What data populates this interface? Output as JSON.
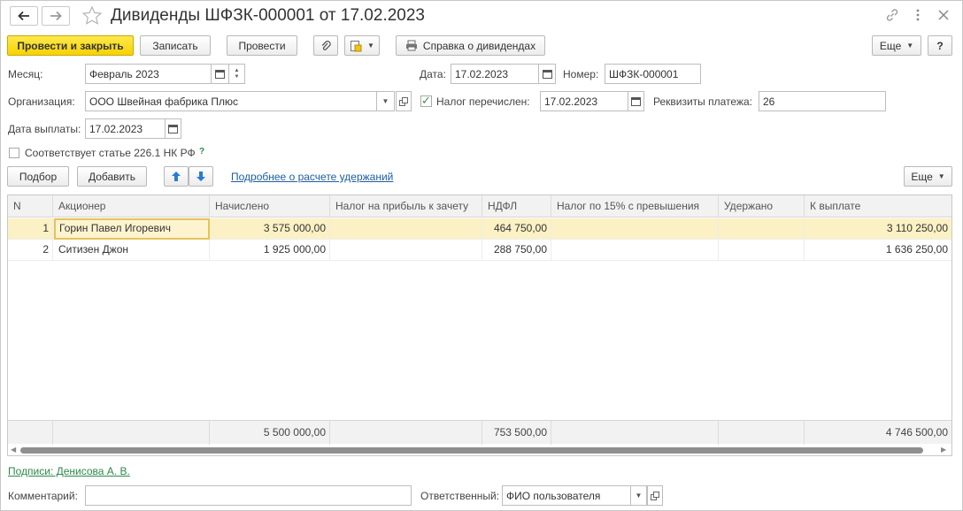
{
  "window": {
    "title": "Дивиденды ШФЗК-000001 от 17.02.2023"
  },
  "toolbar": {
    "post_close": "Провести и закрыть",
    "save": "Записать",
    "post": "Провести",
    "reference": "Справка о дивидендах",
    "more": "Еще",
    "help": "?"
  },
  "form": {
    "month_label": "Месяц:",
    "month_value": "Февраль 2023",
    "date_label": "Дата:",
    "date_value": "17.02.2023",
    "number_label": "Номер:",
    "number_value": "ШФЗК-000001",
    "org_label": "Организация:",
    "org_value": "ООО Швейная фабрика Плюс",
    "tax_paid_label": "Налог перечислен:",
    "tax_paid_date": "17.02.2023",
    "payment_details_label": "Реквизиты платежа:",
    "payment_details_value": "26",
    "pay_date_label": "Дата выплаты:",
    "pay_date_value": "17.02.2023",
    "article_label": "Соответствует статье 226.1 НК РФ",
    "article_help": "?"
  },
  "table_toolbar": {
    "select": "Подбор",
    "add": "Добавить",
    "details_link": "Подробнее о расчете удержаний",
    "more": "Еще"
  },
  "table": {
    "columns": [
      "N",
      "Акционер",
      "Начислено",
      "Налог на прибыль к зачету",
      "НДФЛ",
      "Налог по 15% с превышения",
      "Удержано",
      "К выплате"
    ],
    "rows": [
      {
        "n": "1",
        "shareholder": "Горин Павел Игоревич",
        "accrued": "3 575 000,00",
        "profit_tax": "",
        "ndfl": "464 750,00",
        "tax15": "",
        "withheld": "",
        "payout": "3 110 250,00"
      },
      {
        "n": "2",
        "shareholder": "Ситизен Джон",
        "accrued": "1 925 000,00",
        "profit_tax": "",
        "ndfl": "288 750,00",
        "tax15": "",
        "withheld": "",
        "payout": "1 636 250,00"
      }
    ],
    "totals": {
      "accrued": "5 500 000,00",
      "ndfl": "753 500,00",
      "payout": "4 746 500,00"
    }
  },
  "footer": {
    "signatures_link": "Подписи: Денисова А. В.",
    "comment_label": "Комментарий:",
    "comment_value": "",
    "responsible_label": "Ответственный:",
    "responsible_value": "ФИО пользователя"
  }
}
